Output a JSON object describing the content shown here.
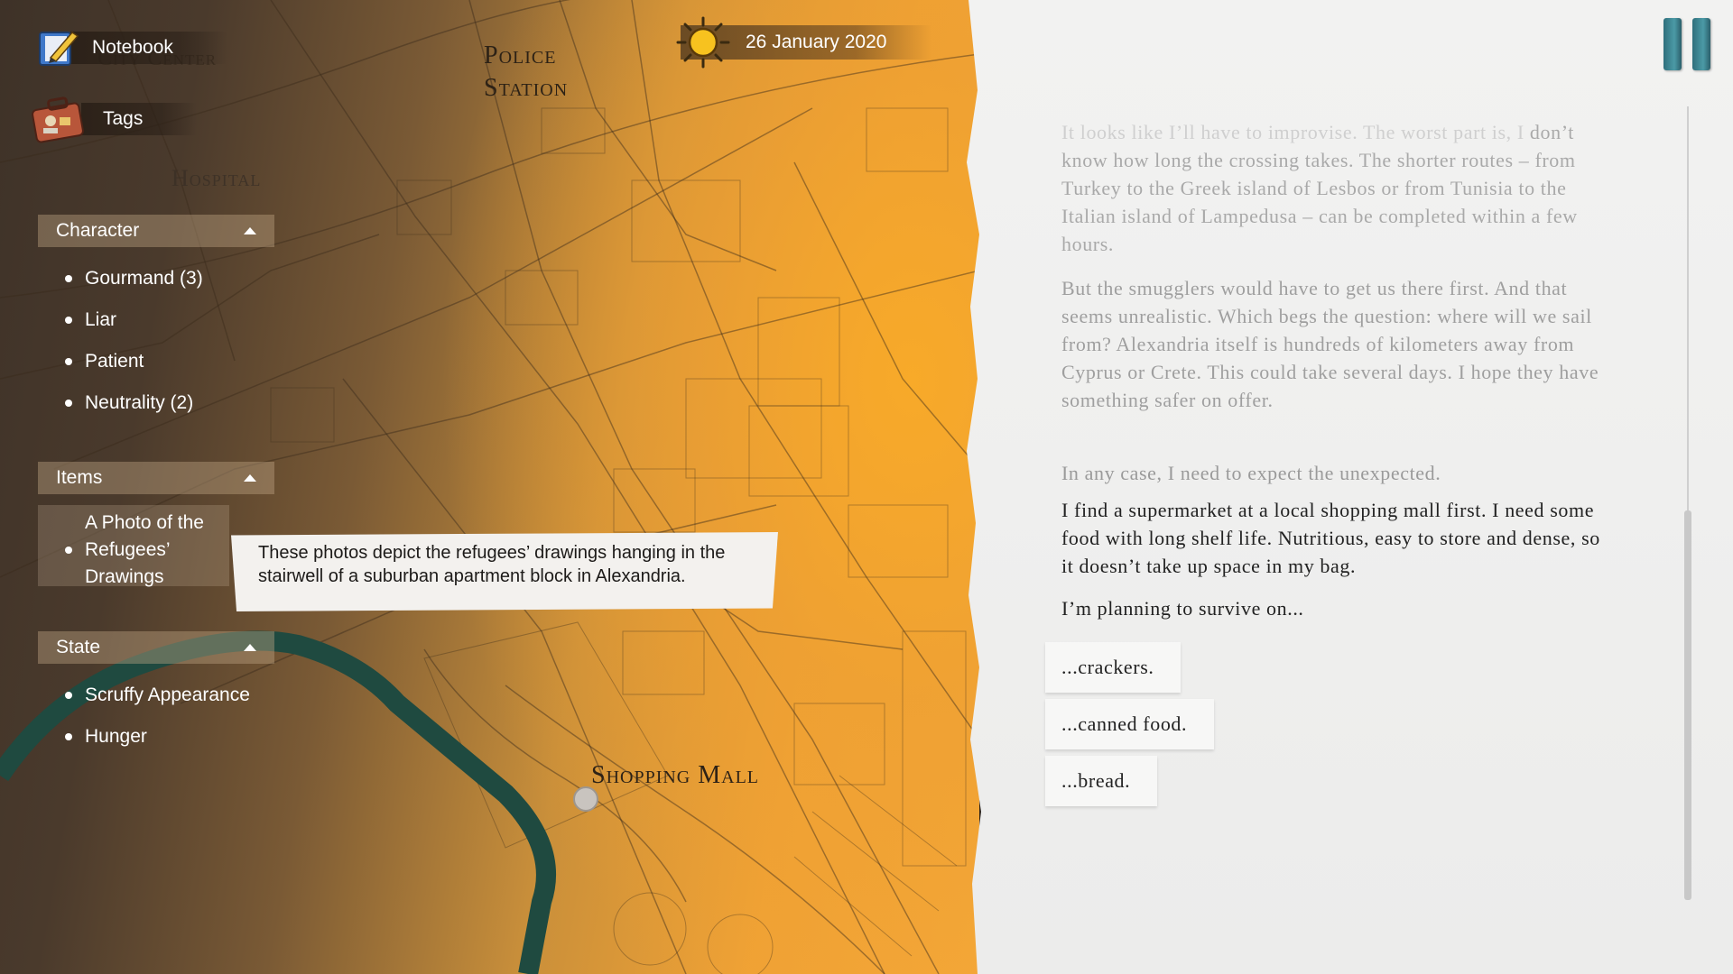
{
  "hud": {
    "notebook_label": "Notebook",
    "tags_label": "Tags",
    "date": "26 January 2020"
  },
  "map": {
    "labels": {
      "police_station": "Police Station",
      "hospital": "Hospital",
      "shopping_mall": "Shopping Mall",
      "city_center": "City Center"
    }
  },
  "tags": {
    "character": {
      "title": "Character",
      "items": [
        "Gourmand  (3)",
        "Liar",
        "Patient",
        "Neutrality  (2)"
      ]
    },
    "items": {
      "title": "Items",
      "items": [
        "A Photo of the Refugees’ Drawings"
      ]
    },
    "state": {
      "title": "State",
      "items": [
        "Scruffy Appearance",
        "Hunger"
      ]
    }
  },
  "tooltip": {
    "text": "These photos depict the refugees’ drawings hanging in the stairwell of a suburban apartment block in Alexandria."
  },
  "story": {
    "p1_faded": "It looks like I’ll have to improvise. The worst part is, I",
    "p1_rest": " don’t know how long the crossing takes. The shorter routes – from Turkey to the Greek island of Lesbos or from Tunisia to the Italian island of Lampedusa –  can be completed within a few hours.",
    "p2": "But the smugglers would have to get us there first. And that seems unrealistic. Which begs the question: where will we sail from? Alexandria itself is hundreds of kilometers away from Cyprus or Crete. This could take several days. I hope they have something safer on offer.",
    "p3": "In any case, I need to expect the unexpected.",
    "p4": "I find a supermarket at a local shopping mall first. I need some food with long shelf life. Nutritious, easy to store and dense, so it doesn’t take up space in my bag.",
    "p5": "I’m planning to survive on..."
  },
  "choices": [
    "...crackers.",
    "...canned food.",
    "...bread."
  ],
  "colors": {
    "map_orange": "#f5a838",
    "map_dark": "#3e3228",
    "river": "#1f4a40",
    "paper": "#f0f0ef",
    "pause_teal": "#3f8a96"
  }
}
